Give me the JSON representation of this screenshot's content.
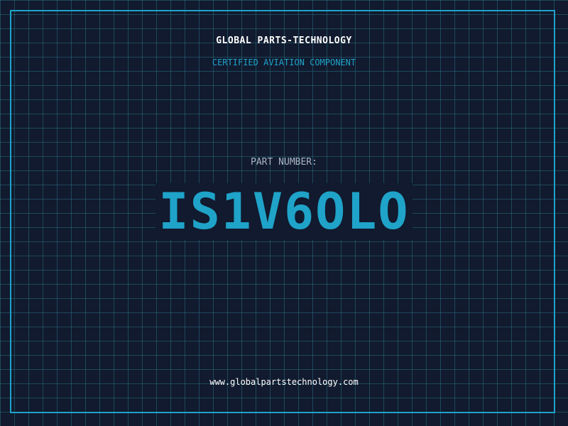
{
  "label": {
    "company": "GLOBAL PARTS-TECHNOLOGY",
    "subtitle": "CERTIFIED AVIATION COMPONENT",
    "part_label": "PART NUMBER:",
    "part_number": "IS1V6OLO",
    "website": "www.globalpartstechnology.com"
  },
  "colors": {
    "background": "#111a2e",
    "grid": "#286e82",
    "accent": "#1fa3c9",
    "text_primary": "#ffffff",
    "text_muted": "#a9b6c6"
  }
}
